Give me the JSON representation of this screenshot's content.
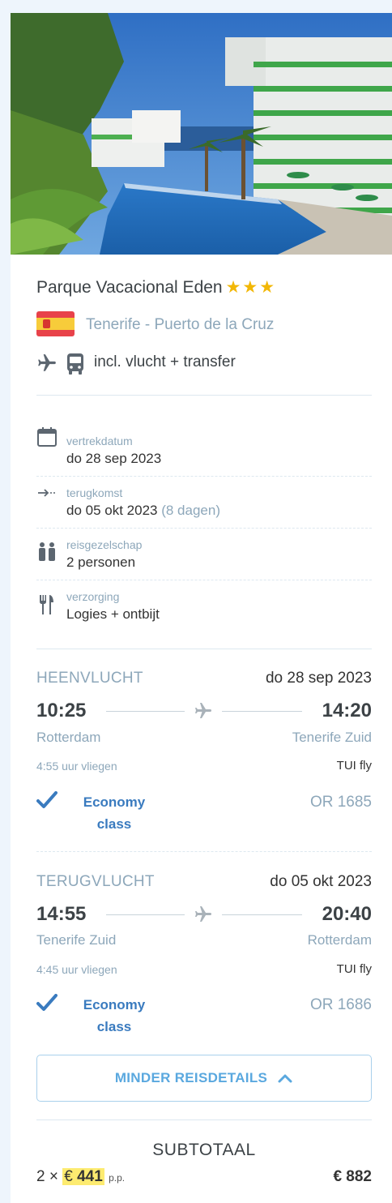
{
  "hotel": {
    "name": "Parque Vacacional Eden",
    "stars": "★★★",
    "location": "Tenerife - Puerto de la Cruz",
    "included": "incl. vlucht + transfer"
  },
  "details": {
    "departure": {
      "label": "vertrekdatum",
      "value": "do 28 sep 2023"
    },
    "return": {
      "label": "terugkomst",
      "value": "do 05 okt 2023",
      "extra": "(8 dagen)"
    },
    "party": {
      "label": "reisgezelschap",
      "value": "2 personen"
    },
    "board": {
      "label": "verzorging",
      "value": "Logies + ontbijt"
    }
  },
  "outbound": {
    "label": "HEENVLUCHT",
    "date": "do 28 sep 2023",
    "dep_time": "10:25",
    "arr_time": "14:20",
    "dep_city": "Rotterdam",
    "arr_city": "Tenerife Zuid",
    "duration": "4:55 uur vliegen",
    "carrier": "TUI fly",
    "class_line1": "Economy",
    "class_line2": "class",
    "flight_no": "OR 1685"
  },
  "inbound": {
    "label": "TERUGVLUCHT",
    "date": "do 05 okt 2023",
    "dep_time": "14:55",
    "arr_time": "20:40",
    "dep_city": "Tenerife Zuid",
    "arr_city": "Rotterdam",
    "duration": "4:45 uur vliegen",
    "carrier": "TUI fly",
    "class_line1": "Economy",
    "class_line2": "class",
    "flight_no": "OR 1686"
  },
  "less_button": "MINDER REISDETAILS",
  "price": {
    "subtotal_label": "SUBTOTAAL",
    "multiplier": "2 ×",
    "currency": "€",
    "per_person": "441",
    "pp_suffix": "p.p.",
    "total": "€ 882"
  },
  "colors": {
    "accent": "#5aa8df",
    "muted": "#8da7ba",
    "star": "#f2b705",
    "highlight": "#fdeb70",
    "check": "#3a7bbf"
  }
}
